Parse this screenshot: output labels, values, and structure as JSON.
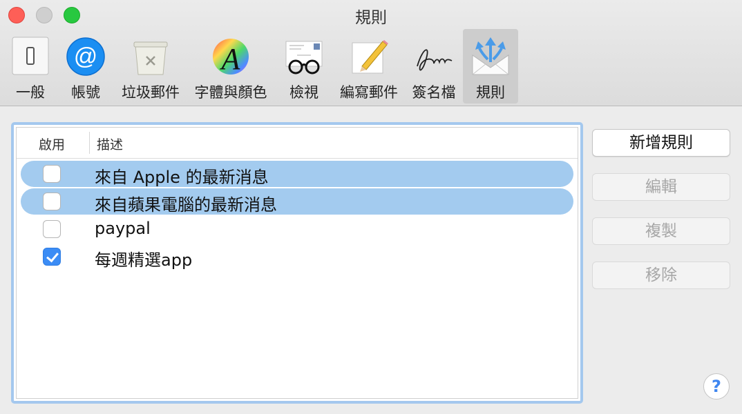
{
  "window": {
    "title": "規則"
  },
  "toolbar": {
    "items": [
      {
        "label": "一般",
        "icon": "toggle-switch-icon"
      },
      {
        "label": "帳號",
        "icon": "at-sign-icon"
      },
      {
        "label": "垃圾郵件",
        "icon": "trash-bin-icon"
      },
      {
        "label": "字體與顏色",
        "icon": "font-color-wheel-icon"
      },
      {
        "label": "檢視",
        "icon": "envelope-glasses-icon"
      },
      {
        "label": "編寫郵件",
        "icon": "pencil-paper-icon"
      },
      {
        "label": "簽名檔",
        "icon": "signature-icon"
      },
      {
        "label": "規則",
        "icon": "mail-rules-icon",
        "selected": true
      }
    ]
  },
  "rules": {
    "columns": {
      "enabled": "啟用",
      "description": "描述"
    },
    "rows": [
      {
        "description": "來自 Apple 的最新消息",
        "enabled": false,
        "selected": true
      },
      {
        "description": "來自蘋果電腦的最新消息",
        "enabled": false,
        "selected": true
      },
      {
        "description": "paypal",
        "enabled": false,
        "selected": false
      },
      {
        "description": "每週精選app",
        "enabled": true,
        "selected": false
      }
    ]
  },
  "buttons": {
    "add": "新增規則",
    "edit": "編輯",
    "duplicate": "複製",
    "remove": "移除",
    "help": "?"
  },
  "colors": {
    "selection": "#a3cbef",
    "focus_ring": "#a4c8ee",
    "checkbox_on": "#3b8cf5",
    "close": "#fe5f57",
    "zoom": "#28c840"
  }
}
